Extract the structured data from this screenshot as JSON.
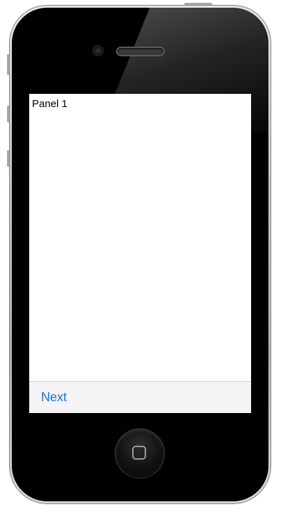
{
  "screen": {
    "panel_title": "Panel 1",
    "next_label": "Next"
  },
  "colors": {
    "accent": "#1a73e8",
    "toolbar_bg": "#f4f4f4",
    "device_face": "#000000"
  },
  "icons": {
    "camera": "front-camera-icon",
    "speaker": "earpiece-speaker-icon",
    "home": "home-button-square-icon"
  }
}
